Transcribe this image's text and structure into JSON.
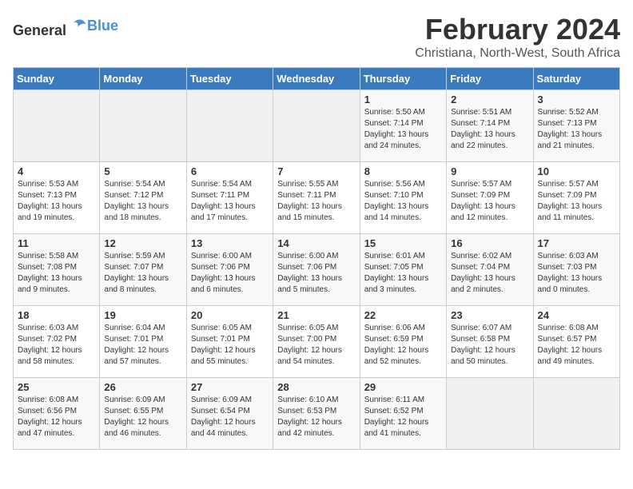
{
  "header": {
    "logo_general": "General",
    "logo_blue": "Blue",
    "month": "February 2024",
    "location": "Christiana, North-West, South Africa"
  },
  "days_of_week": [
    "Sunday",
    "Monday",
    "Tuesday",
    "Wednesday",
    "Thursday",
    "Friday",
    "Saturday"
  ],
  "weeks": [
    [
      {
        "day": "",
        "info": ""
      },
      {
        "day": "",
        "info": ""
      },
      {
        "day": "",
        "info": ""
      },
      {
        "day": "",
        "info": ""
      },
      {
        "day": "1",
        "info": "Sunrise: 5:50 AM\nSunset: 7:14 PM\nDaylight: 13 hours\nand 24 minutes."
      },
      {
        "day": "2",
        "info": "Sunrise: 5:51 AM\nSunset: 7:14 PM\nDaylight: 13 hours\nand 22 minutes."
      },
      {
        "day": "3",
        "info": "Sunrise: 5:52 AM\nSunset: 7:13 PM\nDaylight: 13 hours\nand 21 minutes."
      }
    ],
    [
      {
        "day": "4",
        "info": "Sunrise: 5:53 AM\nSunset: 7:13 PM\nDaylight: 13 hours\nand 19 minutes."
      },
      {
        "day": "5",
        "info": "Sunrise: 5:54 AM\nSunset: 7:12 PM\nDaylight: 13 hours\nand 18 minutes."
      },
      {
        "day": "6",
        "info": "Sunrise: 5:54 AM\nSunset: 7:11 PM\nDaylight: 13 hours\nand 17 minutes."
      },
      {
        "day": "7",
        "info": "Sunrise: 5:55 AM\nSunset: 7:11 PM\nDaylight: 13 hours\nand 15 minutes."
      },
      {
        "day": "8",
        "info": "Sunrise: 5:56 AM\nSunset: 7:10 PM\nDaylight: 13 hours\nand 14 minutes."
      },
      {
        "day": "9",
        "info": "Sunrise: 5:57 AM\nSunset: 7:09 PM\nDaylight: 13 hours\nand 12 minutes."
      },
      {
        "day": "10",
        "info": "Sunrise: 5:57 AM\nSunset: 7:09 PM\nDaylight: 13 hours\nand 11 minutes."
      }
    ],
    [
      {
        "day": "11",
        "info": "Sunrise: 5:58 AM\nSunset: 7:08 PM\nDaylight: 13 hours\nand 9 minutes."
      },
      {
        "day": "12",
        "info": "Sunrise: 5:59 AM\nSunset: 7:07 PM\nDaylight: 13 hours\nand 8 minutes."
      },
      {
        "day": "13",
        "info": "Sunrise: 6:00 AM\nSunset: 7:06 PM\nDaylight: 13 hours\nand 6 minutes."
      },
      {
        "day": "14",
        "info": "Sunrise: 6:00 AM\nSunset: 7:06 PM\nDaylight: 13 hours\nand 5 minutes."
      },
      {
        "day": "15",
        "info": "Sunrise: 6:01 AM\nSunset: 7:05 PM\nDaylight: 13 hours\nand 3 minutes."
      },
      {
        "day": "16",
        "info": "Sunrise: 6:02 AM\nSunset: 7:04 PM\nDaylight: 13 hours\nand 2 minutes."
      },
      {
        "day": "17",
        "info": "Sunrise: 6:03 AM\nSunset: 7:03 PM\nDaylight: 13 hours\nand 0 minutes."
      }
    ],
    [
      {
        "day": "18",
        "info": "Sunrise: 6:03 AM\nSunset: 7:02 PM\nDaylight: 12 hours\nand 58 minutes."
      },
      {
        "day": "19",
        "info": "Sunrise: 6:04 AM\nSunset: 7:01 PM\nDaylight: 12 hours\nand 57 minutes."
      },
      {
        "day": "20",
        "info": "Sunrise: 6:05 AM\nSunset: 7:01 PM\nDaylight: 12 hours\nand 55 minutes."
      },
      {
        "day": "21",
        "info": "Sunrise: 6:05 AM\nSunset: 7:00 PM\nDaylight: 12 hours\nand 54 minutes."
      },
      {
        "day": "22",
        "info": "Sunrise: 6:06 AM\nSunset: 6:59 PM\nDaylight: 12 hours\nand 52 minutes."
      },
      {
        "day": "23",
        "info": "Sunrise: 6:07 AM\nSunset: 6:58 PM\nDaylight: 12 hours\nand 50 minutes."
      },
      {
        "day": "24",
        "info": "Sunrise: 6:08 AM\nSunset: 6:57 PM\nDaylight: 12 hours\nand 49 minutes."
      }
    ],
    [
      {
        "day": "25",
        "info": "Sunrise: 6:08 AM\nSunset: 6:56 PM\nDaylight: 12 hours\nand 47 minutes."
      },
      {
        "day": "26",
        "info": "Sunrise: 6:09 AM\nSunset: 6:55 PM\nDaylight: 12 hours\nand 46 minutes."
      },
      {
        "day": "27",
        "info": "Sunrise: 6:09 AM\nSunset: 6:54 PM\nDaylight: 12 hours\nand 44 minutes."
      },
      {
        "day": "28",
        "info": "Sunrise: 6:10 AM\nSunset: 6:53 PM\nDaylight: 12 hours\nand 42 minutes."
      },
      {
        "day": "29",
        "info": "Sunrise: 6:11 AM\nSunset: 6:52 PM\nDaylight: 12 hours\nand 41 minutes."
      },
      {
        "day": "",
        "info": ""
      },
      {
        "day": "",
        "info": ""
      }
    ]
  ]
}
